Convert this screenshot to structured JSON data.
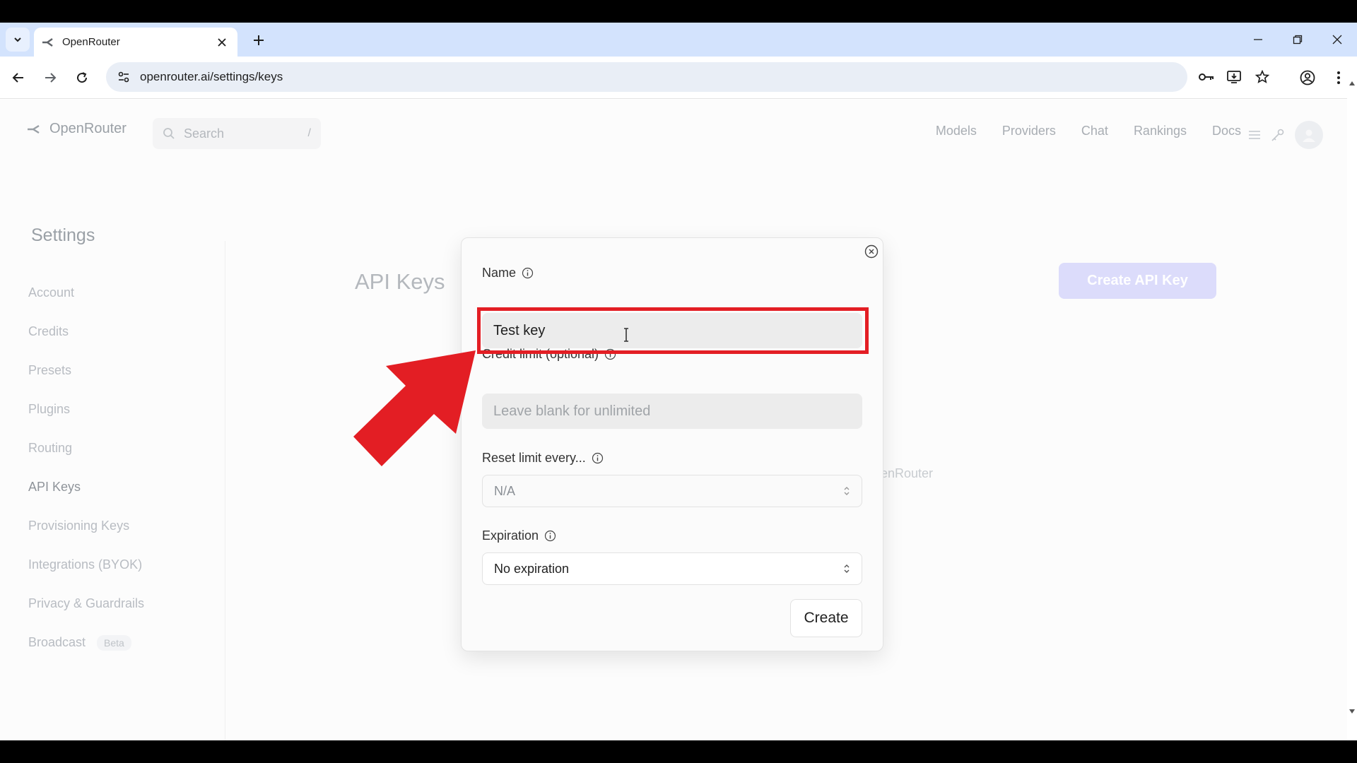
{
  "browser": {
    "tab_title": "OpenRouter",
    "url": "openrouter.ai/settings/keys"
  },
  "site": {
    "brand": "OpenRouter",
    "search_placeholder": "Search",
    "search_shortcut": "/",
    "nav": [
      "Models",
      "Providers",
      "Chat",
      "Rankings",
      "Docs"
    ]
  },
  "settings": {
    "title": "Settings",
    "items": [
      {
        "label": "Account"
      },
      {
        "label": "Credits"
      },
      {
        "label": "Presets"
      },
      {
        "label": "Plugins"
      },
      {
        "label": "Routing"
      },
      {
        "label": "API Keys"
      },
      {
        "label": "Provisioning Keys"
      },
      {
        "label": "Integrations (BYOK)"
      },
      {
        "label": "Privacy & Guardrails"
      },
      {
        "label": "Broadcast",
        "badge": "Beta"
      }
    ]
  },
  "main": {
    "title": "API Keys",
    "create_button": "Create API Key",
    "background_text": "enRouter"
  },
  "modal": {
    "name_label": "Name",
    "name_value": "Test key",
    "credit_label": "Credit limit (optional)",
    "credit_placeholder": "Leave blank for unlimited",
    "reset_label": "Reset limit every...",
    "reset_value": "N/A",
    "expiration_label": "Expiration",
    "expiration_value": "No expiration",
    "create_button": "Create"
  },
  "colors": {
    "highlight": "#e31e24",
    "arrow": "#e31e24"
  }
}
